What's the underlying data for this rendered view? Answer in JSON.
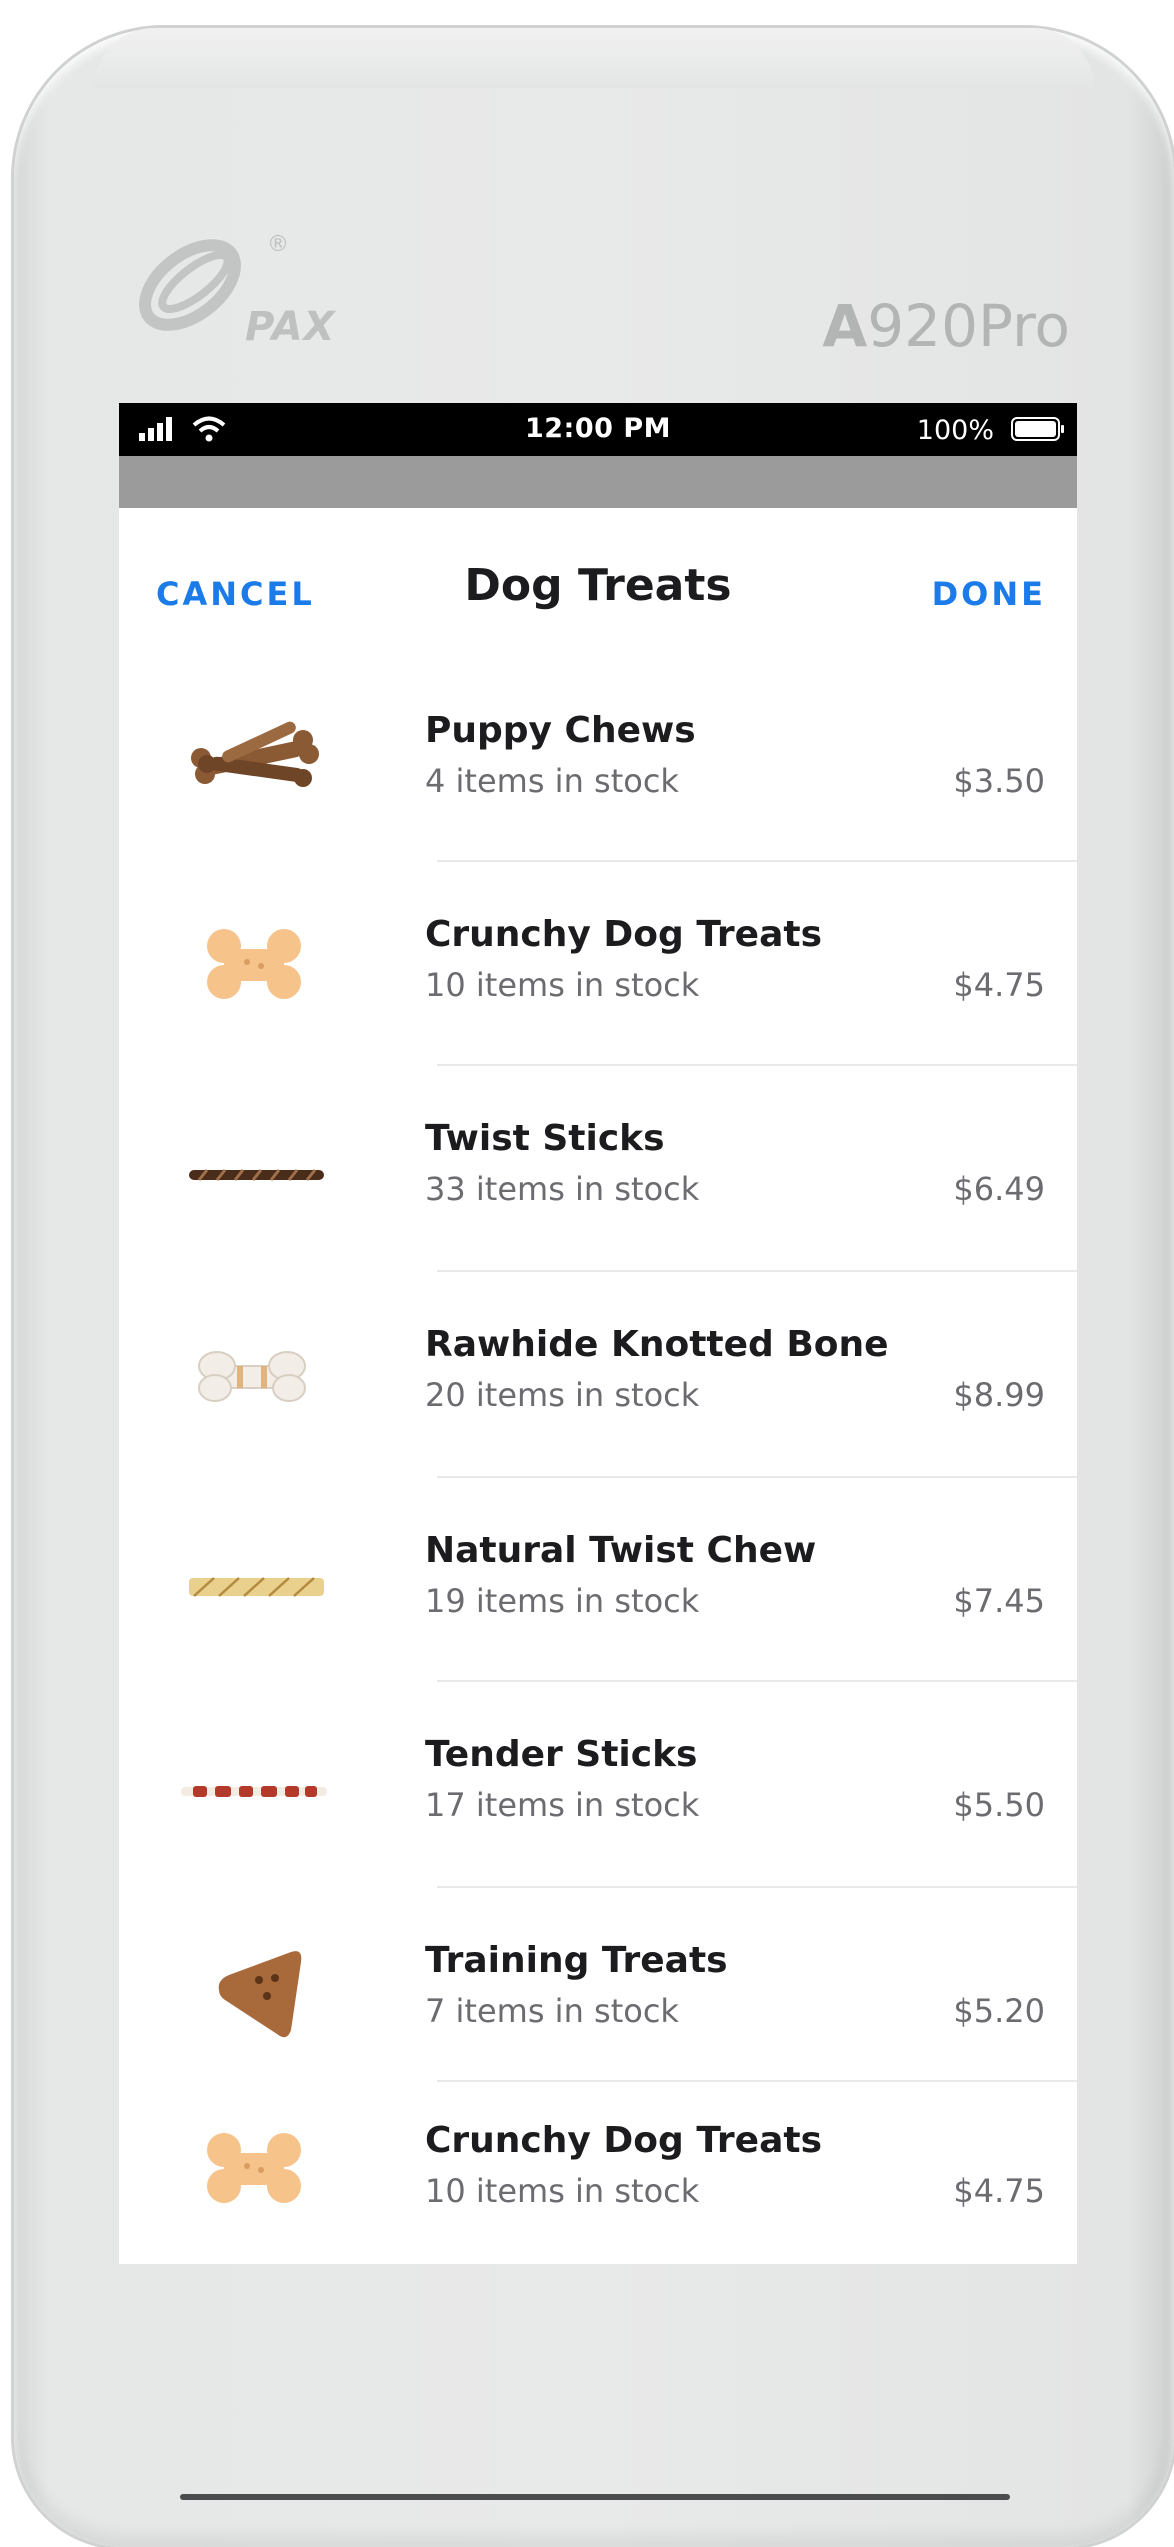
{
  "device": {
    "brand": "PAX",
    "brand_registered": "®",
    "model_prefix": "A",
    "model_suffix": "920Pro"
  },
  "status_bar": {
    "time": "12:00 PM",
    "battery": "100%"
  },
  "header": {
    "cancel_label": "CANCEL",
    "title": "Dog Treats",
    "done_label": "DONE"
  },
  "items": [
    {
      "name": "Puppy Chews",
      "stock": "4 items in stock",
      "price": "$3.50",
      "icon": "chew-bones-icon"
    },
    {
      "name": "Crunchy Dog Treats",
      "stock": "10 items in stock",
      "price": "$4.75",
      "icon": "bone-biscuit-icon"
    },
    {
      "name": "Twist Sticks",
      "stock": "33 items in stock",
      "price": "$6.49",
      "icon": "twist-stick-icon"
    },
    {
      "name": "Rawhide Knotted Bone",
      "stock": "20 items in stock",
      "price": "$8.99",
      "icon": "rawhide-bone-icon"
    },
    {
      "name": "Natural Twist Chew",
      "stock": "19 items in stock",
      "price": "$7.45",
      "icon": "natural-twist-icon"
    },
    {
      "name": "Tender Sticks",
      "stock": "17 items in stock",
      "price": "$5.50",
      "icon": "tender-stick-icon"
    },
    {
      "name": "Training Treats",
      "stock": "7 items in stock",
      "price": "$5.20",
      "icon": "triangle-treat-icon"
    },
    {
      "name": "Crunchy Dog Treats",
      "stock": "10 items in stock",
      "price": "$4.75",
      "icon": "bone-biscuit-icon"
    }
  ],
  "colors": {
    "accent": "#1b7be8",
    "status_bar": "#000000",
    "header_band": "#9b9b9b",
    "text_primary": "#1c1c1e",
    "text_secondary": "#6c6c70"
  }
}
